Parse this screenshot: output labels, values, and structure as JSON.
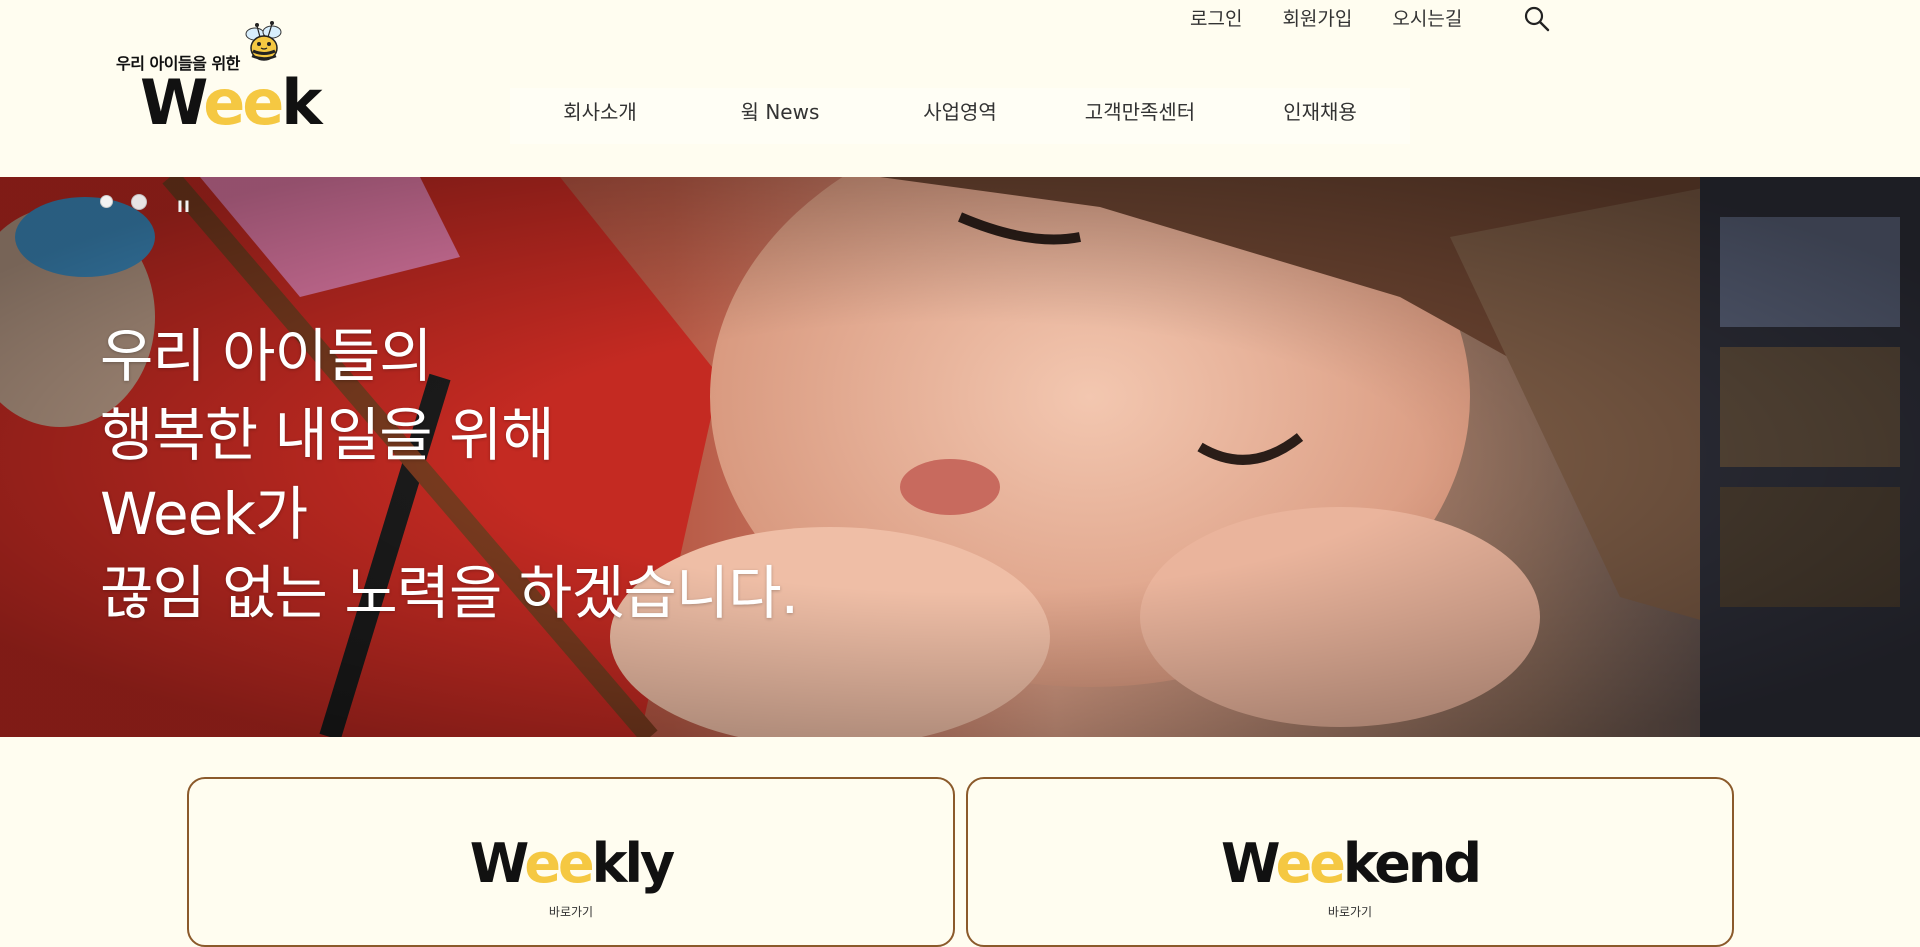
{
  "logo": {
    "tagline": "우리 아이들을 위한",
    "word_prefix": "W",
    "word_highlight": "ee",
    "word_suffix": "k"
  },
  "util_nav": [
    "로그인",
    "회원가입",
    "오시는길"
  ],
  "gnb": [
    "회사소개",
    "윜 News",
    "사업영역",
    "고객만족센터",
    "인재채용"
  ],
  "hero": {
    "lines": [
      "우리 아이들의",
      "행복한 내일을 위해",
      "Week가",
      "끊임 없는 노력을 하겠습니다."
    ],
    "pause_label": "II"
  },
  "cards": [
    {
      "word_prefix": "W",
      "word_highlight": "ee",
      "word_suffix": "kly",
      "link": "바로가기"
    },
    {
      "word_prefix": "W",
      "word_highlight": "ee",
      "word_suffix": "kend",
      "link": "바로가기"
    }
  ],
  "colors": {
    "background": "#fffdf0",
    "accent_yellow": "#f5c842",
    "card_border": "#8b5a2b"
  }
}
